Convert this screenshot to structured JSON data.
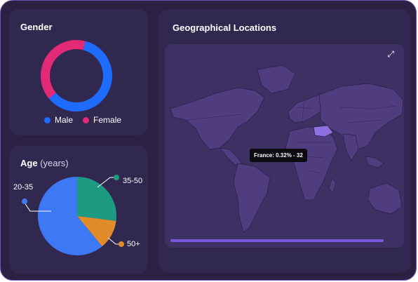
{
  "gender": {
    "title": "Gender",
    "legend": [
      {
        "label": "Male",
        "color": "#1e6bff"
      },
      {
        "label": "Female",
        "color": "#e32a76"
      }
    ],
    "chart_data": {
      "type": "pie",
      "categories": [
        "Male",
        "Female"
      ],
      "values": [
        60,
        40
      ],
      "colors": [
        "#1e6bff",
        "#e32a76"
      ]
    }
  },
  "age": {
    "title": "Age",
    "unit": "(years)",
    "labels": {
      "a": "20-35",
      "b": "35-50",
      "c": "50+"
    },
    "chart_data": {
      "type": "pie",
      "categories": [
        "20-35",
        "35-50",
        "50+"
      ],
      "values": [
        61,
        27,
        12
      ],
      "colors": [
        "#3d78f5",
        "#1d9b82",
        "#e28b2a"
      ]
    }
  },
  "geo": {
    "title": "Geographical Locations",
    "tooltip": "France: 0.32% - 32",
    "expand_icon": "expand-icon",
    "progress_color": "#7b57e0",
    "highlight_color": "#8d6fe0"
  }
}
